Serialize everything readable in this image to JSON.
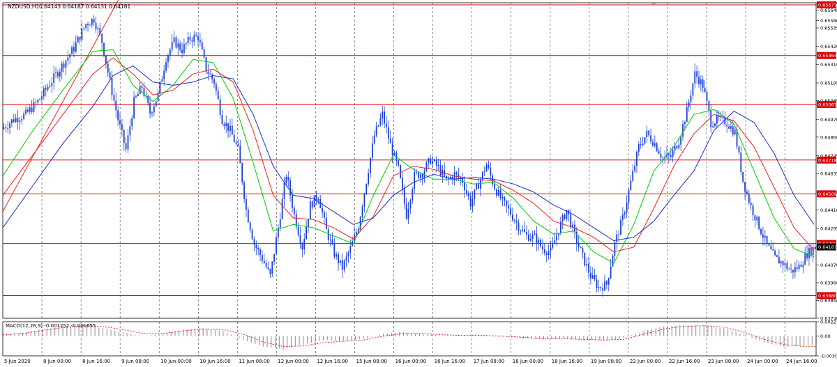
{
  "window": {
    "title": "NZDUSD,H1",
    "ohlc": "0.64143 0.64187 0.64131 0.64181"
  },
  "chart_data": {
    "type": "candlestick",
    "symbol": "NZDUSD",
    "timeframe": "H1",
    "ylim": [
      0.6374,
      0.6569
    ],
    "y_ticks": [
      "0.65690",
      "0.65580",
      "0.65645",
      "0.65535",
      "0.65420",
      "0.65310",
      "0.65195",
      "0.65085",
      "0.64970",
      "0.64860",
      "0.64745",
      "0.64635",
      "0.64520",
      "0.64410",
      "0.64295",
      "0.64181",
      "0.64070",
      "0.63960",
      "0.63850",
      "0.63740"
    ],
    "x_labels": [
      "5 Jun 2020",
      "8 Jun 00:00",
      "8 Jun 16:00",
      "9 Jun 08:00",
      "10 Jun 00:00",
      "10 Jun 16:00",
      "11 Jun 08:00",
      "12 Jun 00:00",
      "12 Jun 16:00",
      "15 Jun 08:00",
      "16 Jun 00:00",
      "16 Jun 16:00",
      "17 Jun 08:00",
      "18 Jun 00:00",
      "18 Jun 16:00",
      "19 Jun 08:00",
      "22 Jun 00:00",
      "22 Jun 16:00",
      "23 Jun 08:00",
      "24 Jun 00:00",
      "24 Jun 16:00"
    ],
    "horizontal_levels": [
      {
        "value": 0.65677,
        "label": "0.65677"
      },
      {
        "value": 0.65364,
        "label": "0.65364"
      },
      {
        "value": 0.65061,
        "label": "0.65061"
      },
      {
        "value": 0.64718,
        "label": "0.64718"
      },
      {
        "value": 0.64509,
        "label": "0.64509"
      },
      {
        "value": 0.64202,
        "label": "0.64202"
      },
      {
        "value": 0.6388,
        "label": "0.63880"
      }
    ],
    "current_price": {
      "value": 0.64181,
      "label": "0.64181"
    },
    "close_path": [
      [
        0,
        0.6491
      ],
      [
        6,
        0.6497
      ],
      [
        12,
        0.65
      ],
      [
        18,
        0.6508
      ],
      [
        24,
        0.6519
      ],
      [
        30,
        0.653
      ],
      [
        36,
        0.6541
      ],
      [
        42,
        0.6556
      ],
      [
        46,
        0.6559
      ],
      [
        50,
        0.6545
      ],
      [
        54,
        0.652
      ],
      [
        58,
        0.6497
      ],
      [
        62,
        0.6478
      ],
      [
        66,
        0.6508
      ],
      [
        70,
        0.6517
      ],
      [
        74,
        0.6501
      ],
      [
        78,
        0.6512
      ],
      [
        82,
        0.6535
      ],
      [
        86,
        0.6545
      ],
      [
        90,
        0.654
      ],
      [
        94,
        0.6547
      ],
      [
        98,
        0.6548
      ],
      [
        102,
        0.6528
      ],
      [
        106,
        0.652
      ],
      [
        110,
        0.6497
      ],
      [
        114,
        0.649
      ],
      [
        118,
        0.6478
      ],
      [
        122,
        0.6441
      ],
      [
        126,
        0.642
      ],
      [
        130,
        0.6411
      ],
      [
        134,
        0.64
      ],
      [
        138,
        0.643
      ],
      [
        142,
        0.6463
      ],
      [
        146,
        0.6438
      ],
      [
        150,
        0.6418
      ],
      [
        154,
        0.6444
      ],
      [
        158,
        0.645
      ],
      [
        162,
        0.6428
      ],
      [
        166,
        0.6414
      ],
      [
        170,
        0.6405
      ],
      [
        174,
        0.6417
      ],
      [
        178,
        0.6431
      ],
      [
        182,
        0.6459
      ],
      [
        186,
        0.6487
      ],
      [
        190,
        0.65
      ],
      [
        194,
        0.6481
      ],
      [
        198,
        0.6466
      ],
      [
        202,
        0.6438
      ],
      [
        206,
        0.6462
      ],
      [
        210,
        0.6464
      ],
      [
        214,
        0.6472
      ],
      [
        218,
        0.6467
      ],
      [
        222,
        0.6459
      ],
      [
        226,
        0.6463
      ],
      [
        230,
        0.6459
      ],
      [
        234,
        0.6445
      ],
      [
        238,
        0.6457
      ],
      [
        242,
        0.6469
      ],
      [
        246,
        0.6455
      ],
      [
        250,
        0.6446
      ],
      [
        254,
        0.6439
      ],
      [
        258,
        0.6431
      ],
      [
        262,
        0.6425
      ],
      [
        266,
        0.6424
      ],
      [
        270,
        0.6417
      ],
      [
        274,
        0.6415
      ],
      [
        278,
        0.6429
      ],
      [
        282,
        0.6441
      ],
      [
        286,
        0.6425
      ],
      [
        290,
        0.6412
      ],
      [
        294,
        0.64
      ],
      [
        298,
        0.6393
      ],
      [
        302,
        0.6395
      ],
      [
        306,
        0.642
      ],
      [
        310,
        0.6436
      ],
      [
        314,
        0.6458
      ],
      [
        318,
        0.648
      ],
      [
        322,
        0.6488
      ],
      [
        326,
        0.6482
      ],
      [
        330,
        0.6473
      ],
      [
        334,
        0.6474
      ],
      [
        338,
        0.6484
      ],
      [
        342,
        0.6502
      ],
      [
        346,
        0.6525
      ],
      [
        350,
        0.6518
      ],
      [
        354,
        0.6495
      ],
      [
        358,
        0.6497
      ],
      [
        362,
        0.6495
      ],
      [
        366,
        0.6489
      ],
      [
        370,
        0.6459
      ],
      [
        374,
        0.6443
      ],
      [
        378,
        0.6431
      ],
      [
        382,
        0.6419
      ],
      [
        386,
        0.6411
      ],
      [
        390,
        0.6408
      ],
      [
        394,
        0.6403
      ],
      [
        398,
        0.6406
      ],
      [
        402,
        0.6414
      ],
      [
        406,
        0.6418
      ]
    ],
    "moving_averages": [
      {
        "color": "#00cc00",
        "points": [
          [
            0,
            0.6462
          ],
          [
            15,
            0.649
          ],
          [
            30,
            0.6515
          ],
          [
            45,
            0.6539
          ],
          [
            55,
            0.654
          ],
          [
            65,
            0.6518
          ],
          [
            75,
            0.6508
          ],
          [
            85,
            0.6518
          ],
          [
            95,
            0.6534
          ],
          [
            105,
            0.6532
          ],
          [
            115,
            0.651
          ],
          [
            125,
            0.647
          ],
          [
            135,
            0.6428
          ],
          [
            145,
            0.6432
          ],
          [
            155,
            0.643
          ],
          [
            165,
            0.6425
          ],
          [
            175,
            0.642
          ],
          [
            185,
            0.645
          ],
          [
            195,
            0.6475
          ],
          [
            205,
            0.6466
          ],
          [
            215,
            0.646
          ],
          [
            225,
            0.646
          ],
          [
            235,
            0.6457
          ],
          [
            245,
            0.6458
          ],
          [
            255,
            0.6448
          ],
          [
            265,
            0.6434
          ],
          [
            275,
            0.6426
          ],
          [
            285,
            0.6428
          ],
          [
            295,
            0.6415
          ],
          [
            305,
            0.6408
          ],
          [
            315,
            0.6432
          ],
          [
            325,
            0.6465
          ],
          [
            335,
            0.648
          ],
          [
            345,
            0.65
          ],
          [
            355,
            0.6503
          ],
          [
            365,
            0.6494
          ],
          [
            375,
            0.6465
          ],
          [
            385,
            0.6436
          ],
          [
            395,
            0.6417
          ],
          [
            405,
            0.6412
          ]
        ]
      },
      {
        "color": "#ee2020",
        "points": [
          [
            0,
            0.645
          ],
          [
            15,
            0.6475
          ],
          [
            30,
            0.65
          ],
          [
            45,
            0.6525
          ],
          [
            55,
            0.6535
          ],
          [
            65,
            0.6525
          ],
          [
            75,
            0.6512
          ],
          [
            85,
            0.6515
          ],
          [
            95,
            0.6525
          ],
          [
            105,
            0.6528
          ],
          [
            115,
            0.652
          ],
          [
            125,
            0.649
          ],
          [
            135,
            0.645
          ],
          [
            145,
            0.6436
          ],
          [
            155,
            0.6435
          ],
          [
            165,
            0.643
          ],
          [
            175,
            0.6423
          ],
          [
            185,
            0.6437
          ],
          [
            195,
            0.6462
          ],
          [
            205,
            0.6468
          ],
          [
            215,
            0.6466
          ],
          [
            225,
            0.6462
          ],
          [
            235,
            0.646
          ],
          [
            245,
            0.6459
          ],
          [
            255,
            0.6453
          ],
          [
            265,
            0.6445
          ],
          [
            275,
            0.6434
          ],
          [
            285,
            0.643
          ],
          [
            295,
            0.6424
          ],
          [
            305,
            0.6415
          ],
          [
            315,
            0.6418
          ],
          [
            325,
            0.6442
          ],
          [
            335,
            0.6468
          ],
          [
            345,
            0.6488
          ],
          [
            355,
            0.65
          ],
          [
            365,
            0.6496
          ],
          [
            375,
            0.648
          ],
          [
            385,
            0.6455
          ],
          [
            395,
            0.643
          ],
          [
            405,
            0.6416
          ]
        ]
      },
      {
        "color": "#1a2ecc",
        "points": [
          [
            0,
            0.643
          ],
          [
            15,
            0.6456
          ],
          [
            30,
            0.6482
          ],
          [
            45,
            0.6505
          ],
          [
            55,
            0.6524
          ],
          [
            65,
            0.653
          ],
          [
            75,
            0.652
          ],
          [
            85,
            0.6518
          ],
          [
            95,
            0.652
          ],
          [
            105,
            0.6524
          ],
          [
            115,
            0.6522
          ],
          [
            125,
            0.65
          ],
          [
            135,
            0.6468
          ],
          [
            145,
            0.645
          ],
          [
            155,
            0.6448
          ],
          [
            165,
            0.644
          ],
          [
            175,
            0.6432
          ],
          [
            185,
            0.6436
          ],
          [
            195,
            0.645
          ],
          [
            205,
            0.6458
          ],
          [
            215,
            0.6463
          ],
          [
            225,
            0.646
          ],
          [
            235,
            0.6461
          ],
          [
            245,
            0.646
          ],
          [
            255,
            0.6457
          ],
          [
            265,
            0.6452
          ],
          [
            275,
            0.6444
          ],
          [
            285,
            0.6438
          ],
          [
            295,
            0.643
          ],
          [
            305,
            0.6422
          ],
          [
            315,
            0.6424
          ],
          [
            325,
            0.6434
          ],
          [
            335,
            0.645
          ],
          [
            345,
            0.6465
          ],
          [
            355,
            0.649
          ],
          [
            365,
            0.6502
          ],
          [
            375,
            0.6495
          ],
          [
            385,
            0.6476
          ],
          [
            395,
            0.645
          ],
          [
            405,
            0.6432
          ]
        ]
      }
    ],
    "trendline": {
      "color": "#ee2020",
      "points": [
        [
          0,
          0.644
        ],
        [
          60,
          0.6576
        ]
      ]
    },
    "macd": {
      "label": "MACD(12,26,9) -0.001252 -0.001655",
      "y_ticks": [
        "0.00221",
        "0.00",
        "-0.00303"
      ],
      "ylim": [
        -0.00303,
        0.00221
      ],
      "histogram": [
        [
          0,
          0.0003
        ],
        [
          10,
          0.0005
        ],
        [
          20,
          0.001
        ],
        [
          30,
          0.0015
        ],
        [
          40,
          0.0017
        ],
        [
          50,
          0.0012
        ],
        [
          60,
          0.0006
        ],
        [
          70,
          0.0
        ],
        [
          80,
          0.0004
        ],
        [
          90,
          0.001
        ],
        [
          100,
          0.0012
        ],
        [
          110,
          0.0008
        ],
        [
          120,
          -0.0006
        ],
        [
          130,
          -0.0016
        ],
        [
          140,
          -0.002
        ],
        [
          150,
          -0.0013
        ],
        [
          160,
          -0.0006
        ],
        [
          170,
          -0.0008
        ],
        [
          180,
          -0.0004
        ],
        [
          190,
          0.0004
        ],
        [
          200,
          0.0006
        ],
        [
          210,
          0.0003
        ],
        [
          220,
          0.0001
        ],
        [
          230,
          0.0
        ],
        [
          240,
          0.0001
        ],
        [
          250,
          -0.0001
        ],
        [
          260,
          -0.0003
        ],
        [
          270,
          -0.0005
        ],
        [
          280,
          -0.0004
        ],
        [
          290,
          -0.0006
        ],
        [
          300,
          -0.0007
        ],
        [
          310,
          -0.0003
        ],
        [
          320,
          0.0008
        ],
        [
          330,
          0.0015
        ],
        [
          340,
          0.0017
        ],
        [
          350,
          0.0016
        ],
        [
          360,
          0.0012
        ],
        [
          370,
          0.0002
        ],
        [
          380,
          -0.001
        ],
        [
          390,
          -0.0016
        ],
        [
          400,
          -0.0015
        ],
        [
          406,
          -0.0013
        ]
      ],
      "signal": [
        [
          0,
          0.0002
        ],
        [
          10,
          0.0004
        ],
        [
          20,
          0.0009
        ],
        [
          30,
          0.0013
        ],
        [
          40,
          0.0016
        ],
        [
          50,
          0.0015
        ],
        [
          60,
          0.001
        ],
        [
          70,
          0.0004
        ],
        [
          80,
          0.0004
        ],
        [
          90,
          0.0008
        ],
        [
          100,
          0.0011
        ],
        [
          110,
          0.001
        ],
        [
          120,
          0.0003
        ],
        [
          130,
          -0.0009
        ],
        [
          140,
          -0.0016
        ],
        [
          150,
          -0.0015
        ],
        [
          160,
          -0.001
        ],
        [
          170,
          -0.0008
        ],
        [
          180,
          -0.0006
        ],
        [
          190,
          0.0
        ],
        [
          200,
          0.0004
        ],
        [
          210,
          0.0004
        ],
        [
          220,
          0.0002
        ],
        [
          230,
          0.0001
        ],
        [
          240,
          0.0001
        ],
        [
          250,
          0.0
        ],
        [
          260,
          -0.0002
        ],
        [
          270,
          -0.0004
        ],
        [
          280,
          -0.0004
        ],
        [
          290,
          -0.0005
        ],
        [
          300,
          -0.0006
        ],
        [
          310,
          -0.0005
        ],
        [
          320,
          0.0003
        ],
        [
          330,
          0.0011
        ],
        [
          340,
          0.0015
        ],
        [
          350,
          0.0016
        ],
        [
          360,
          0.0014
        ],
        [
          370,
          0.0006
        ],
        [
          380,
          -0.0005
        ],
        [
          390,
          -0.0013
        ],
        [
          400,
          -0.0016
        ],
        [
          406,
          -0.0016
        ]
      ]
    },
    "colors": {
      "candles": "#1a3fd6",
      "level_line": "#dd0000",
      "level_label_bg": "#dd0000",
      "price_label_bg": "#000000",
      "grid": "#444444",
      "macd_hist": "#888888",
      "macd_signal": "#dd0000"
    }
  }
}
